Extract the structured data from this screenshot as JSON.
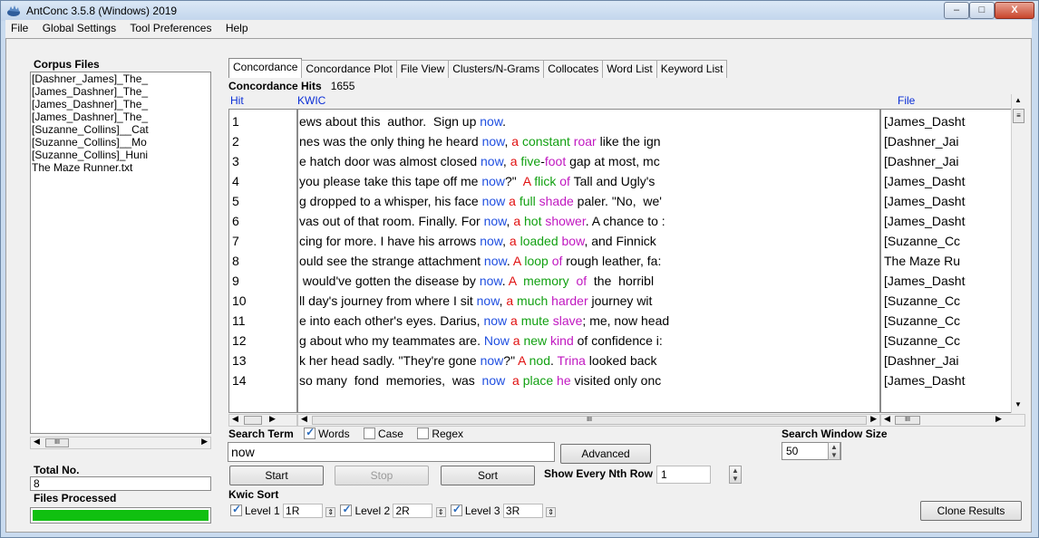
{
  "window": {
    "title": "AntConc 3.5.8 (Windows) 2019",
    "min": "–",
    "max": "□",
    "close": "X"
  },
  "menu": [
    "File",
    "Global Settings",
    "Tool Preferences",
    "Help"
  ],
  "sidebar": {
    "title": "Corpus Files",
    "files": [
      "[Dashner_James]_The_",
      "[James_Dashner]_The_",
      "[James_Dashner]_The_",
      "[James_Dashner]_The_",
      "[Suzanne_Collins]__Cat",
      "[Suzanne_Collins]__Mo",
      "[Suzanne_Collins]_Huni",
      "The Maze Runner.txt"
    ],
    "total_label": "Total No.",
    "total_value": "8",
    "processed_label": "Files Processed",
    "progress": 1.0
  },
  "tabs": [
    "Concordance",
    "Concordance Plot",
    "File View",
    "Clusters/N-Grams",
    "Collocates",
    "Word List",
    "Keyword List"
  ],
  "concordance": {
    "hits_label": "Concordance Hits",
    "hits_value": "1655",
    "col_hit": "Hit",
    "col_kwic": "KWIC",
    "col_file": "File",
    "rows": [
      {
        "hit": "1",
        "kwic": [
          [
            "ews about this  author.  Sign up ",
            "k"
          ],
          [
            "now",
            "b"
          ],
          [
            ".",
            "k"
          ]
        ],
        "file": "[James_Dasht"
      },
      {
        "hit": "2",
        "kwic": [
          [
            "nes was the only thing he heard ",
            "k"
          ],
          [
            "now",
            "b"
          ],
          [
            ", ",
            "k"
          ],
          [
            "a",
            "r"
          ],
          [
            " ",
            "k"
          ],
          [
            "constant",
            "g"
          ],
          [
            " ",
            "k"
          ],
          [
            "roar",
            "m"
          ],
          [
            " like the ign",
            "k"
          ]
        ],
        "file": "[Dashner_Jai"
      },
      {
        "hit": "3",
        "kwic": [
          [
            "e hatch door was almost closed ",
            "k"
          ],
          [
            "now",
            "b"
          ],
          [
            ", ",
            "k"
          ],
          [
            "a",
            "r"
          ],
          [
            " ",
            "k"
          ],
          [
            "five",
            "g"
          ],
          [
            "-",
            "k"
          ],
          [
            "foot",
            "m"
          ],
          [
            " gap at most, mc",
            "k"
          ]
        ],
        "file": "[Dashner_Jai"
      },
      {
        "hit": "4",
        "kwic": [
          [
            "you please take this tape off me ",
            "k"
          ],
          [
            "now",
            "b"
          ],
          [
            "?\"  ",
            "k"
          ],
          [
            "A",
            "r"
          ],
          [
            " ",
            "k"
          ],
          [
            "flick",
            "g"
          ],
          [
            " ",
            "k"
          ],
          [
            "of",
            "m"
          ],
          [
            " Tall and Ugly's",
            "k"
          ]
        ],
        "file": "[James_Dasht"
      },
      {
        "hit": "5",
        "kwic": [
          [
            "g dropped to a whisper, his face ",
            "k"
          ],
          [
            "now",
            "b"
          ],
          [
            " ",
            "k"
          ],
          [
            "a",
            "r"
          ],
          [
            " ",
            "k"
          ],
          [
            "full",
            "g"
          ],
          [
            " ",
            "k"
          ],
          [
            "shade",
            "m"
          ],
          [
            " paler. \"No,  we'",
            "k"
          ]
        ],
        "file": "[James_Dasht"
      },
      {
        "hit": "6",
        "kwic": [
          [
            "vas out of that room. Finally. For ",
            "k"
          ],
          [
            "now",
            "b"
          ],
          [
            ", ",
            "k"
          ],
          [
            "a",
            "r"
          ],
          [
            " ",
            "k"
          ],
          [
            "hot",
            "g"
          ],
          [
            " ",
            "k"
          ],
          [
            "shower",
            "m"
          ],
          [
            ". A chance to :",
            "k"
          ]
        ],
        "file": "[James_Dasht"
      },
      {
        "hit": "7",
        "kwic": [
          [
            "cing for more. I have his arrows ",
            "k"
          ],
          [
            "now",
            "b"
          ],
          [
            ", ",
            "k"
          ],
          [
            "a",
            "r"
          ],
          [
            " ",
            "k"
          ],
          [
            "loaded",
            "g"
          ],
          [
            " ",
            "k"
          ],
          [
            "bow",
            "m"
          ],
          [
            ", and Finnick",
            "k"
          ]
        ],
        "file": "[Suzanne_Cc"
      },
      {
        "hit": "8",
        "kwic": [
          [
            "ould see the strange attachment ",
            "k"
          ],
          [
            "now",
            "b"
          ],
          [
            ". ",
            "k"
          ],
          [
            "A",
            "r"
          ],
          [
            " ",
            "k"
          ],
          [
            "loop",
            "g"
          ],
          [
            " ",
            "k"
          ],
          [
            "of",
            "m"
          ],
          [
            " rough leather, fa:",
            "k"
          ]
        ],
        "file": "The Maze Ru"
      },
      {
        "hit": "9",
        "kwic": [
          [
            " would've gotten the disease by ",
            "k"
          ],
          [
            "now",
            "b"
          ],
          [
            ". ",
            "k"
          ],
          [
            "A",
            "r"
          ],
          [
            "  ",
            "k"
          ],
          [
            "memory",
            "g"
          ],
          [
            "  ",
            "k"
          ],
          [
            "of",
            "m"
          ],
          [
            "  the  horribl",
            "k"
          ]
        ],
        "file": "[James_Dasht"
      },
      {
        "hit": "10",
        "kwic": [
          [
            "ll day's journey from where I sit ",
            "k"
          ],
          [
            "now",
            "b"
          ],
          [
            ", ",
            "k"
          ],
          [
            "a",
            "r"
          ],
          [
            " ",
            "k"
          ],
          [
            "much",
            "g"
          ],
          [
            " ",
            "k"
          ],
          [
            "harder",
            "m"
          ],
          [
            " journey wit",
            "k"
          ]
        ],
        "file": "[Suzanne_Cc"
      },
      {
        "hit": "11",
        "kwic": [
          [
            "e into each other's eyes. Darius, ",
            "k"
          ],
          [
            "now",
            "b"
          ],
          [
            " ",
            "k"
          ],
          [
            "a",
            "r"
          ],
          [
            " ",
            "k"
          ],
          [
            "mute",
            "g"
          ],
          [
            " ",
            "k"
          ],
          [
            "slave",
            "m"
          ],
          [
            "; me, now head",
            "k"
          ]
        ],
        "file": "[Suzanne_Cc"
      },
      {
        "hit": "12",
        "kwic": [
          [
            "g about who my teammates are. ",
            "k"
          ],
          [
            "Now",
            "b"
          ],
          [
            " ",
            "k"
          ],
          [
            "a",
            "r"
          ],
          [
            " ",
            "k"
          ],
          [
            "new",
            "g"
          ],
          [
            " ",
            "k"
          ],
          [
            "kind",
            "m"
          ],
          [
            " of confidence i:",
            "k"
          ]
        ],
        "file": "[Suzanne_Cc"
      },
      {
        "hit": "13",
        "kwic": [
          [
            "k her head sadly. \"They're gone ",
            "k"
          ],
          [
            "now",
            "b"
          ],
          [
            "?\" ",
            "k"
          ],
          [
            "A",
            "r"
          ],
          [
            " ",
            "k"
          ],
          [
            "nod",
            "g"
          ],
          [
            ". ",
            "k"
          ],
          [
            "Trina",
            "m"
          ],
          [
            " looked back",
            "k"
          ]
        ],
        "file": "[Dashner_Jai"
      },
      {
        "hit": "14",
        "kwic": [
          [
            "so many  fond  memories,  was  ",
            "k"
          ],
          [
            "now",
            "b"
          ],
          [
            "  ",
            "k"
          ],
          [
            "a",
            "r"
          ],
          [
            " ",
            "k"
          ],
          [
            "place",
            "g"
          ],
          [
            " ",
            "k"
          ],
          [
            "he",
            "m"
          ],
          [
            " visited only onc",
            "k"
          ]
        ],
        "file": "[James_Dasht"
      }
    ]
  },
  "search": {
    "term_label": "Search Term",
    "words_label": "Words",
    "words": true,
    "case_label": "Case",
    "case": false,
    "regex_label": "Regex",
    "regex": false,
    "value": "now",
    "advanced": "Advanced",
    "window_label": "Search Window Size",
    "window_value": "50"
  },
  "buttons": {
    "start": "Start",
    "stop": "Stop",
    "sort": "Sort",
    "clone": "Clone Results"
  },
  "nth": {
    "label": "Show Every Nth Row",
    "value": "1"
  },
  "kwic_sort": {
    "label": "Kwic Sort",
    "levels": [
      {
        "label": "Level 1",
        "value": "1R"
      },
      {
        "label": "Level 2",
        "value": "2R"
      },
      {
        "label": "Level 3",
        "value": "3R"
      }
    ]
  },
  "colors": {
    "kwic_blue": "#1f4fe0",
    "red": "#e01010",
    "green": "#12a012",
    "magenta": "#c018c0",
    "progress": "#10c010"
  },
  "scroll": {
    "ellipsis": "III"
  }
}
